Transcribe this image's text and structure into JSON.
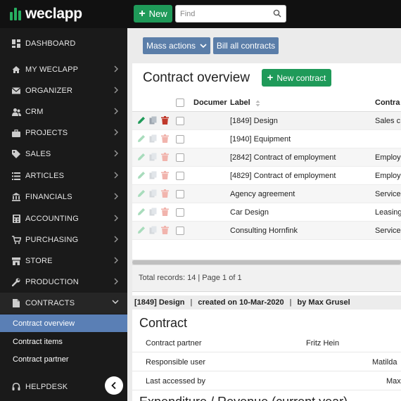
{
  "app": {
    "logo_text": "weclapp",
    "new_label": "New",
    "search_placeholder": "Find"
  },
  "sidebar": {
    "items": [
      {
        "label": "DASHBOARD",
        "icon": "dashboard-icon"
      },
      {
        "label": "MY WECLAPP",
        "icon": "home-icon"
      },
      {
        "label": "ORGANIZER",
        "icon": "envelope-icon"
      },
      {
        "label": "CRM",
        "icon": "people-icon"
      },
      {
        "label": "PROJECTS",
        "icon": "briefcase-icon"
      },
      {
        "label": "SALES",
        "icon": "tag-icon"
      },
      {
        "label": "ARTICLES",
        "icon": "list-icon"
      },
      {
        "label": "FINANCIALS",
        "icon": "bank-icon"
      },
      {
        "label": "ACCOUNTING",
        "icon": "calculator-icon"
      },
      {
        "label": "PURCHASING",
        "icon": "cart-icon"
      },
      {
        "label": "STORE",
        "icon": "store-icon"
      },
      {
        "label": "PRODUCTION",
        "icon": "wrench-icon"
      },
      {
        "label": "CONTRACTS",
        "icon": "document-icon"
      }
    ],
    "contracts_subitems": [
      "Contract overview",
      "Contract items",
      "Contract partner"
    ],
    "active_subitem": "Contract overview",
    "helpdesk_label": "HELPDESK"
  },
  "toolbar": {
    "mass_actions_label": "Mass actions",
    "bill_all_label": "Bill all contracts"
  },
  "page": {
    "title": "Contract overview",
    "new_contract_label": "New contract"
  },
  "table": {
    "headers": {
      "document": "Documer",
      "label": "Label",
      "contract": "Contra"
    },
    "rows": [
      {
        "label": "[1849] Design",
        "contract": "Sales c"
      },
      {
        "label": "[1940] Equipment",
        "contract": ""
      },
      {
        "label": "[2842] Contract of employment",
        "contract": "Employ"
      },
      {
        "label": "[4829] Contract of employment",
        "contract": "Employ"
      },
      {
        "label": "Agency agreement",
        "contract": "Service"
      },
      {
        "label": "Car Design",
        "contract": "Leasing"
      },
      {
        "label": "Consulting Hornfink",
        "contract": "Service"
      }
    ],
    "total_text": "Total records: 14 | Page 1 of 1"
  },
  "detail": {
    "header_title": "[1849] Design",
    "header_created": "created on 10-Mar-2020",
    "header_by": "by Max Grusel",
    "separator": "|",
    "section_contract": "Contract",
    "fields": [
      {
        "key": "Contract partner",
        "value": "Fritz Hein"
      },
      {
        "key": "Responsible user",
        "value": "Matilda"
      },
      {
        "key": "Last accessed by",
        "value": "Max"
      }
    ],
    "section_expenditure": "Expenditure / Revenue (current year)"
  },
  "colors": {
    "brand_green": "#1f9a59",
    "action_blue": "#5b7ea9",
    "active_sub": "#5a7fb5",
    "delete_red": "#c0392b"
  }
}
